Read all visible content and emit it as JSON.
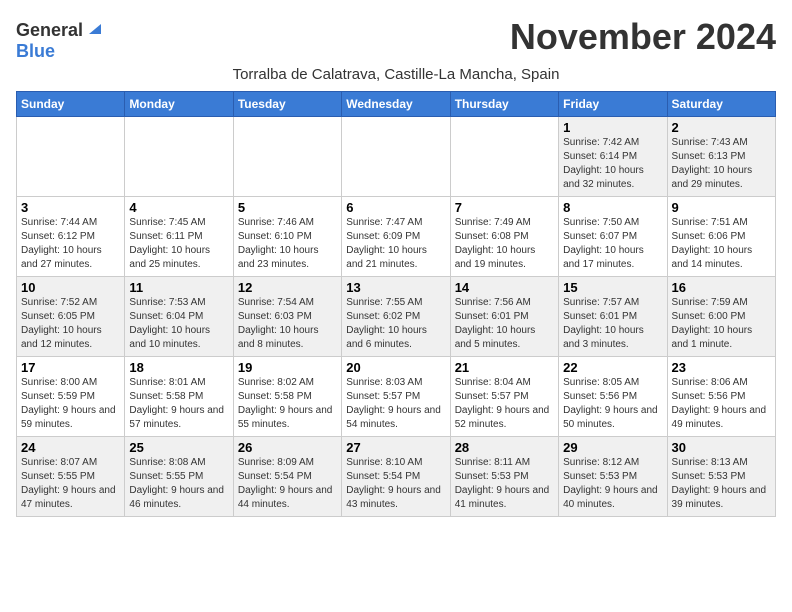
{
  "header": {
    "logo_general": "General",
    "logo_blue": "Blue",
    "month_title": "November 2024",
    "subtitle": "Torralba de Calatrava, Castille-La Mancha, Spain"
  },
  "days_of_week": [
    "Sunday",
    "Monday",
    "Tuesday",
    "Wednesday",
    "Thursday",
    "Friday",
    "Saturday"
  ],
  "weeks": [
    [
      {
        "day": "",
        "info": ""
      },
      {
        "day": "",
        "info": ""
      },
      {
        "day": "",
        "info": ""
      },
      {
        "day": "",
        "info": ""
      },
      {
        "day": "",
        "info": ""
      },
      {
        "day": "1",
        "info": "Sunrise: 7:42 AM\nSunset: 6:14 PM\nDaylight: 10 hours and 32 minutes."
      },
      {
        "day": "2",
        "info": "Sunrise: 7:43 AM\nSunset: 6:13 PM\nDaylight: 10 hours and 29 minutes."
      }
    ],
    [
      {
        "day": "3",
        "info": "Sunrise: 7:44 AM\nSunset: 6:12 PM\nDaylight: 10 hours and 27 minutes."
      },
      {
        "day": "4",
        "info": "Sunrise: 7:45 AM\nSunset: 6:11 PM\nDaylight: 10 hours and 25 minutes."
      },
      {
        "day": "5",
        "info": "Sunrise: 7:46 AM\nSunset: 6:10 PM\nDaylight: 10 hours and 23 minutes."
      },
      {
        "day": "6",
        "info": "Sunrise: 7:47 AM\nSunset: 6:09 PM\nDaylight: 10 hours and 21 minutes."
      },
      {
        "day": "7",
        "info": "Sunrise: 7:49 AM\nSunset: 6:08 PM\nDaylight: 10 hours and 19 minutes."
      },
      {
        "day": "8",
        "info": "Sunrise: 7:50 AM\nSunset: 6:07 PM\nDaylight: 10 hours and 17 minutes."
      },
      {
        "day": "9",
        "info": "Sunrise: 7:51 AM\nSunset: 6:06 PM\nDaylight: 10 hours and 14 minutes."
      }
    ],
    [
      {
        "day": "10",
        "info": "Sunrise: 7:52 AM\nSunset: 6:05 PM\nDaylight: 10 hours and 12 minutes."
      },
      {
        "day": "11",
        "info": "Sunrise: 7:53 AM\nSunset: 6:04 PM\nDaylight: 10 hours and 10 minutes."
      },
      {
        "day": "12",
        "info": "Sunrise: 7:54 AM\nSunset: 6:03 PM\nDaylight: 10 hours and 8 minutes."
      },
      {
        "day": "13",
        "info": "Sunrise: 7:55 AM\nSunset: 6:02 PM\nDaylight: 10 hours and 6 minutes."
      },
      {
        "day": "14",
        "info": "Sunrise: 7:56 AM\nSunset: 6:01 PM\nDaylight: 10 hours and 5 minutes."
      },
      {
        "day": "15",
        "info": "Sunrise: 7:57 AM\nSunset: 6:01 PM\nDaylight: 10 hours and 3 minutes."
      },
      {
        "day": "16",
        "info": "Sunrise: 7:59 AM\nSunset: 6:00 PM\nDaylight: 10 hours and 1 minute."
      }
    ],
    [
      {
        "day": "17",
        "info": "Sunrise: 8:00 AM\nSunset: 5:59 PM\nDaylight: 9 hours and 59 minutes."
      },
      {
        "day": "18",
        "info": "Sunrise: 8:01 AM\nSunset: 5:58 PM\nDaylight: 9 hours and 57 minutes."
      },
      {
        "day": "19",
        "info": "Sunrise: 8:02 AM\nSunset: 5:58 PM\nDaylight: 9 hours and 55 minutes."
      },
      {
        "day": "20",
        "info": "Sunrise: 8:03 AM\nSunset: 5:57 PM\nDaylight: 9 hours and 54 minutes."
      },
      {
        "day": "21",
        "info": "Sunrise: 8:04 AM\nSunset: 5:57 PM\nDaylight: 9 hours and 52 minutes."
      },
      {
        "day": "22",
        "info": "Sunrise: 8:05 AM\nSunset: 5:56 PM\nDaylight: 9 hours and 50 minutes."
      },
      {
        "day": "23",
        "info": "Sunrise: 8:06 AM\nSunset: 5:56 PM\nDaylight: 9 hours and 49 minutes."
      }
    ],
    [
      {
        "day": "24",
        "info": "Sunrise: 8:07 AM\nSunset: 5:55 PM\nDaylight: 9 hours and 47 minutes."
      },
      {
        "day": "25",
        "info": "Sunrise: 8:08 AM\nSunset: 5:55 PM\nDaylight: 9 hours and 46 minutes."
      },
      {
        "day": "26",
        "info": "Sunrise: 8:09 AM\nSunset: 5:54 PM\nDaylight: 9 hours and 44 minutes."
      },
      {
        "day": "27",
        "info": "Sunrise: 8:10 AM\nSunset: 5:54 PM\nDaylight: 9 hours and 43 minutes."
      },
      {
        "day": "28",
        "info": "Sunrise: 8:11 AM\nSunset: 5:53 PM\nDaylight: 9 hours and 41 minutes."
      },
      {
        "day": "29",
        "info": "Sunrise: 8:12 AM\nSunset: 5:53 PM\nDaylight: 9 hours and 40 minutes."
      },
      {
        "day": "30",
        "info": "Sunrise: 8:13 AM\nSunset: 5:53 PM\nDaylight: 9 hours and 39 minutes."
      }
    ]
  ]
}
